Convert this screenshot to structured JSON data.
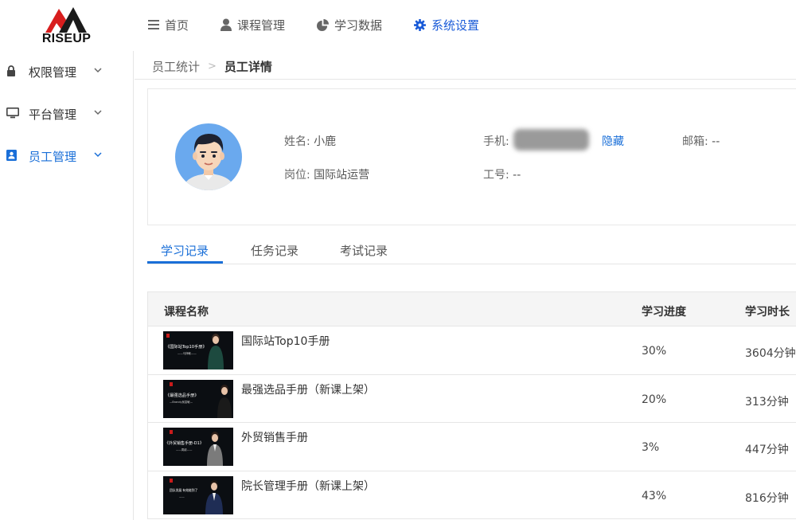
{
  "brand": {
    "logo_text": "RISEUP",
    "accent": "#1a5bd8",
    "logo_red": "#d81e1e"
  },
  "topnav": [
    {
      "label": "首页",
      "icon": "menu-icon",
      "active": false
    },
    {
      "label": "课程管理",
      "icon": "user-icon",
      "active": false
    },
    {
      "label": "学习数据",
      "icon": "pie-chart-icon",
      "active": false
    },
    {
      "label": "系统设置",
      "icon": "gear-icon",
      "active": true
    }
  ],
  "sidebar": {
    "items": [
      {
        "label": "权限管理",
        "icon": "lock-icon",
        "active": false
      },
      {
        "label": "平台管理",
        "icon": "monitor-icon",
        "active": false
      },
      {
        "label": "员工管理",
        "icon": "contacts-icon",
        "active": true
      }
    ]
  },
  "breadcrumb": {
    "parent": "员工统计",
    "separator": ">",
    "current": "员工详情"
  },
  "profile": {
    "name_label": "姓名:",
    "name": "小鹿",
    "phone_label": "手机:",
    "hide_label": "隐藏",
    "email_label": "邮箱:",
    "email": "--",
    "post_label": "岗位:",
    "post": "国际站运营",
    "job_no_label": "工号:",
    "job_no": "--"
  },
  "tabs": [
    {
      "label": "学习记录",
      "active": true
    },
    {
      "label": "任务记录",
      "active": false
    },
    {
      "label": "考试记录",
      "active": false
    }
  ],
  "table": {
    "columns": [
      "课程名称",
      "学习进度",
      "学习时长"
    ],
    "rows": [
      {
        "name": "国际站Top10手册",
        "progress": "30%",
        "duration": "3604分钟",
        "thumb_title": "《国际站Top10手册》",
        "thumb_sub": "——马拜敏——"
      },
      {
        "name": "最强选品手册（新课上架）",
        "progress": "20%",
        "duration": "313分钟",
        "thumb_title": "《最强选品手册》",
        "thumb_sub": "—Brandy吴嘉敏—"
      },
      {
        "name": "外贸销售手册",
        "progress": "3%",
        "duration": "447分钟",
        "thumb_title": "《外贸销售手册-D1》",
        "thumb_sub": "——周颖——"
      },
      {
        "name": "院长管理手册（新课上架）",
        "progress": "43%",
        "duration": "816分钟",
        "thumb_title": "团队发展 有效能到了",
        "thumb_sub": "——"
      }
    ]
  }
}
